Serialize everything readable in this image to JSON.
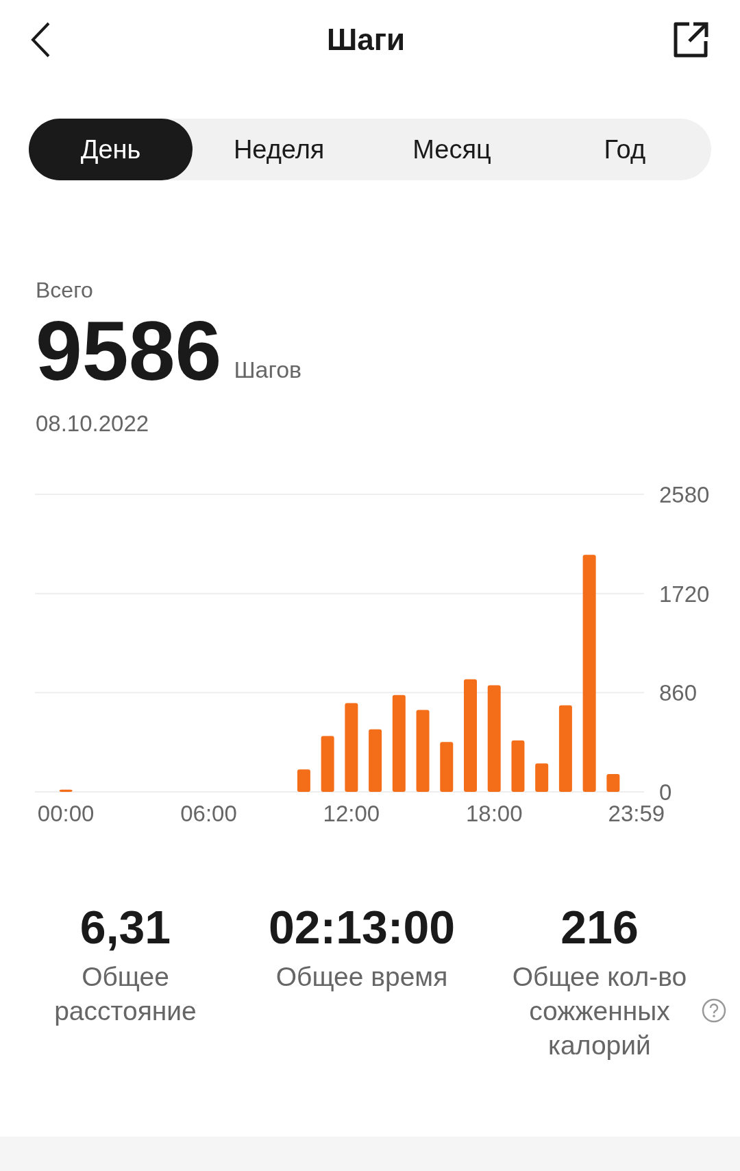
{
  "header": {
    "title": "Шаги"
  },
  "tabs": [
    {
      "label": "День",
      "selected": true
    },
    {
      "label": "Неделя",
      "selected": false
    },
    {
      "label": "Месяц",
      "selected": false
    },
    {
      "label": "Год",
      "selected": false
    }
  ],
  "summary": {
    "label": "Всего",
    "value": "9586",
    "unit": "Шагов",
    "date": "08.10.2022"
  },
  "chart_data": {
    "type": "bar",
    "x": [
      0,
      10,
      11,
      12,
      13,
      14,
      15,
      16,
      17,
      18,
      19,
      20,
      21,
      22,
      23
    ],
    "values": [
      20,
      194,
      485,
      770,
      543,
      840,
      711,
      433,
      976,
      925,
      446,
      246,
      750,
      2056,
      155
    ],
    "color": "#f46e1a",
    "xlim": [
      -1.3,
      24.3
    ],
    "ylim": [
      0,
      2580
    ],
    "yticks": [
      0,
      860,
      1720,
      2580
    ],
    "xticks": [
      {
        "value": 0,
        "label": "00:00"
      },
      {
        "value": 6,
        "label": "06:00"
      },
      {
        "value": 12,
        "label": "12:00"
      },
      {
        "value": 18,
        "label": "18:00"
      },
      {
        "value": 23.98,
        "label": "23:59"
      }
    ]
  },
  "stats": [
    {
      "value": "6,31",
      "label": "Общее расстояние",
      "help": false
    },
    {
      "value": "02:13:00",
      "label": "Общее время",
      "help": false
    },
    {
      "value": "216",
      "label": "Общее кол-во сожженных калорий",
      "help": true
    }
  ]
}
